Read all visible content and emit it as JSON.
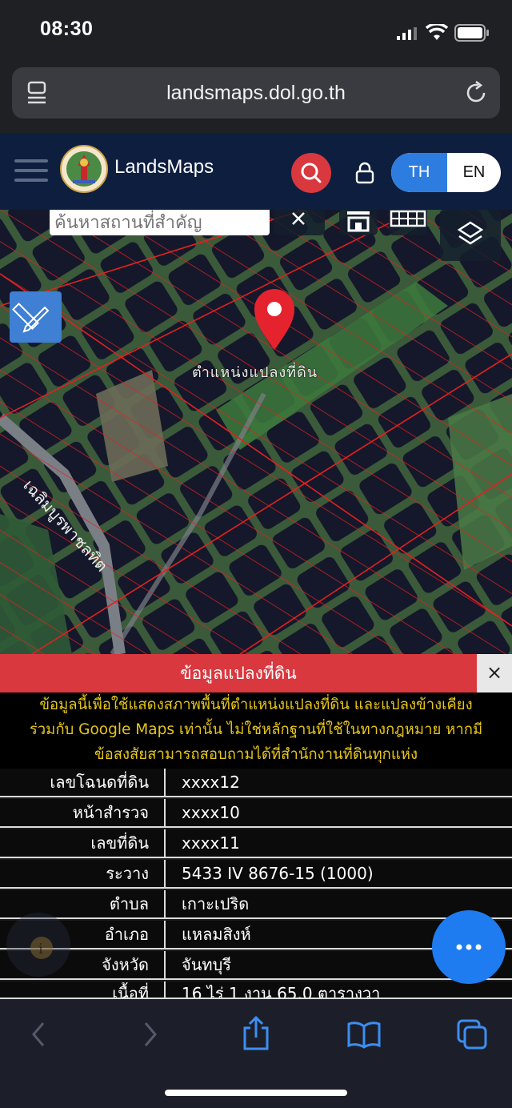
{
  "status_bar": {
    "time": "08:30"
  },
  "browser": {
    "url": "landsmaps.dol.go.th"
  },
  "app": {
    "brand": "LandsMaps",
    "lang_th": "TH",
    "lang_en": "EN"
  },
  "map": {
    "search_placeholder": "ค้นหาสถานที่สำคัญ",
    "marker_label": "ตำแหน่งแปลงที่ดิน",
    "road_label": "เฉลิมบูรพาชลทิต"
  },
  "panel": {
    "title": "ข้อมูลแปลงที่ดิน",
    "close": "×",
    "disclaimer_lines": [
      "ข้อมูลนี้เพื่อใช้แสดงสภาพพื้นที่ตำแหน่งแปลงที่ดิน และแปลงข้างเคียง",
      "ร่วมกับ Google Maps เท่านั้น ไม่ใช่หลักฐานที่ใช้ในทางกฎหมาย หากมี",
      "ข้อสงสัยสามารถสอบถามได้ที่สำนักงานที่ดินทุกแห่ง"
    ],
    "rows": [
      {
        "label": "เลขโฉนดที่ดิน",
        "value": "xxxx12"
      },
      {
        "label": "หน้าสำรวจ",
        "value": "xxxx10"
      },
      {
        "label": "เลขที่ดิน",
        "value": "xxxx11"
      },
      {
        "label": "ระวาง",
        "value": "5433 IV 8676-15 (1000)"
      },
      {
        "label": "ตำบล",
        "value": "เกาะเปริด"
      },
      {
        "label": "อำเภอ",
        "value": "แหลมสิงห์"
      },
      {
        "label": "จังหวัด",
        "value": "จันทบุรี"
      },
      {
        "label": "เนื้อที่",
        "value": "16 ไร่ 1 งาน 65.0 ตารางวา"
      }
    ]
  },
  "colors": {
    "header_bg": "#0e1e3f",
    "panel_red": "#d9383f",
    "disclaimer_yellow": "#e6c619",
    "accent_blue": "#2d7de1"
  }
}
